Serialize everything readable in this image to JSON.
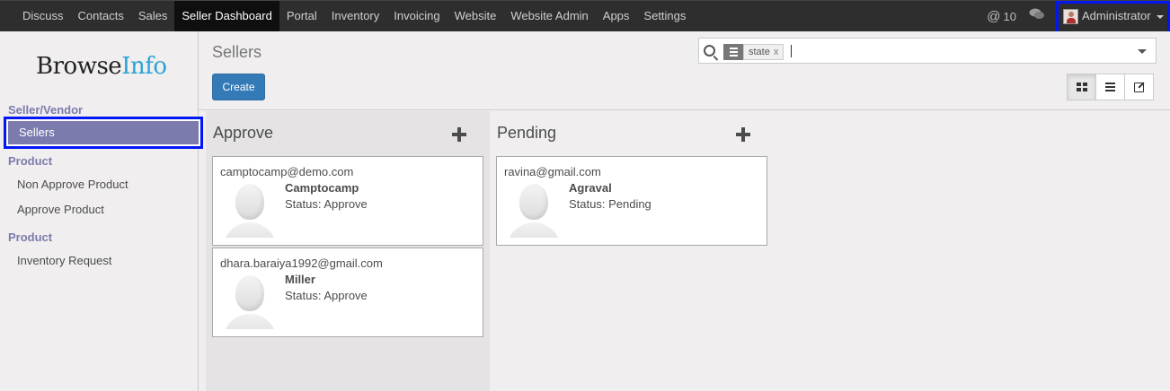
{
  "topbar": {
    "menu": [
      "Discuss",
      "Contacts",
      "Sales",
      "Seller Dashboard",
      "Portal",
      "Inventory",
      "Invoicing",
      "Website",
      "Website Admin",
      "Apps",
      "Settings"
    ],
    "active_menu": "Seller Dashboard",
    "mentions_count": "10",
    "user_name": "Administrator"
  },
  "sidebar": {
    "logo_part1": "Browse",
    "logo_part2": "Info",
    "sections": [
      {
        "title": "Seller/Vendor",
        "items": [
          "Sellers"
        ]
      },
      {
        "title": "Product",
        "items": [
          "Non Approve Product",
          "Approve Product"
        ]
      },
      {
        "title": "Product",
        "items": [
          "Inventory Request"
        ]
      }
    ],
    "active_item": "Sellers"
  },
  "control_panel": {
    "title": "Sellers",
    "create_label": "Create",
    "search": {
      "facet_value": "state",
      "facet_remove": "x",
      "query": ""
    },
    "views": [
      "kanban",
      "list",
      "form"
    ],
    "active_view": "kanban"
  },
  "kanban": {
    "columns": [
      {
        "title": "Approve",
        "cards": [
          {
            "email": "camptocamp@demo.com",
            "name": "Camptocamp",
            "status": "Status: Approve"
          },
          {
            "email": "dhara.baraiya1992@gmail.com",
            "name": "Miller",
            "status": "Status: Approve"
          }
        ]
      },
      {
        "title": "Pending",
        "cards": [
          {
            "email": "ravina@gmail.com",
            "name": "Agraval",
            "status": "Status: Pending"
          }
        ]
      }
    ]
  },
  "colors": {
    "topbar": "#2e2e2e",
    "primary": "#337ab7",
    "sidebar_active": "#7c7bad",
    "highlight_box": "#0016f5",
    "logo_accent": "#29a3d6"
  }
}
